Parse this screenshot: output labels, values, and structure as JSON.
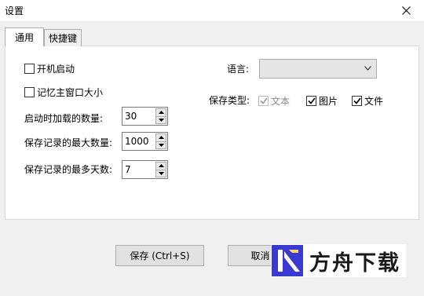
{
  "window": {
    "title": "设置",
    "close_icon": "close-icon"
  },
  "tabs": [
    {
      "label": "通用",
      "active": true
    },
    {
      "label": "快捷键",
      "active": false
    }
  ],
  "general": {
    "autostart": {
      "label": "开机启动",
      "checked": false
    },
    "remember_window": {
      "label": "记忆主窗口大小",
      "checked": false
    },
    "load_count": {
      "label": "启动时加载的数量:",
      "value": "30"
    },
    "max_records": {
      "label": "保存记录的最大数量:",
      "value": "1000"
    },
    "max_days": {
      "label": "保存记录的最多天数:",
      "value": "7"
    },
    "language": {
      "label": "语言:",
      "value": ""
    },
    "save_types": {
      "label": "保存类型:",
      "text": {
        "label": "文本",
        "checked": true,
        "disabled": true
      },
      "image": {
        "label": "图片",
        "checked": true,
        "disabled": false
      },
      "file": {
        "label": "文件",
        "checked": true,
        "disabled": false
      }
    }
  },
  "footer": {
    "save_label": "保存 (Ctrl+S)",
    "cancel_label": "取消"
  },
  "watermark": {
    "text": "方舟下载"
  },
  "colors": {
    "accent": "#3a3ad0",
    "panel": "#ffffff",
    "dialog": "#f0f0f0"
  }
}
